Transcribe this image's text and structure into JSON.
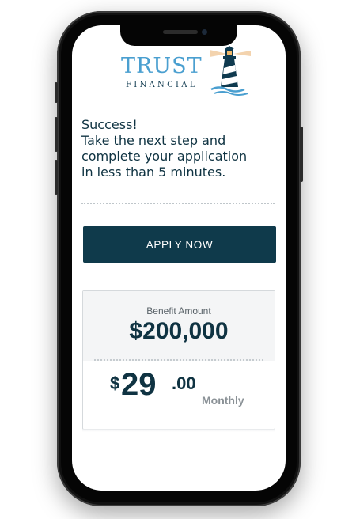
{
  "brand": {
    "name_primary": "TRUST",
    "name_secondary": "FINANCIAL",
    "primary_color": "#0f3a4b",
    "accent_color": "#4a9fd0"
  },
  "headline": {
    "line1": "Success!",
    "line2": "Take the next step and",
    "line3": "complete your application",
    "line4": "in less than 5 minutes."
  },
  "cta": {
    "label": "APPLY NOW"
  },
  "benefit": {
    "label": "Benefit Amount",
    "amount": "$200,000"
  },
  "premium": {
    "currency": "$",
    "whole": "29",
    "cents": ".00",
    "period": "Monthly"
  },
  "icons": {
    "logo": "lighthouse-icon"
  }
}
